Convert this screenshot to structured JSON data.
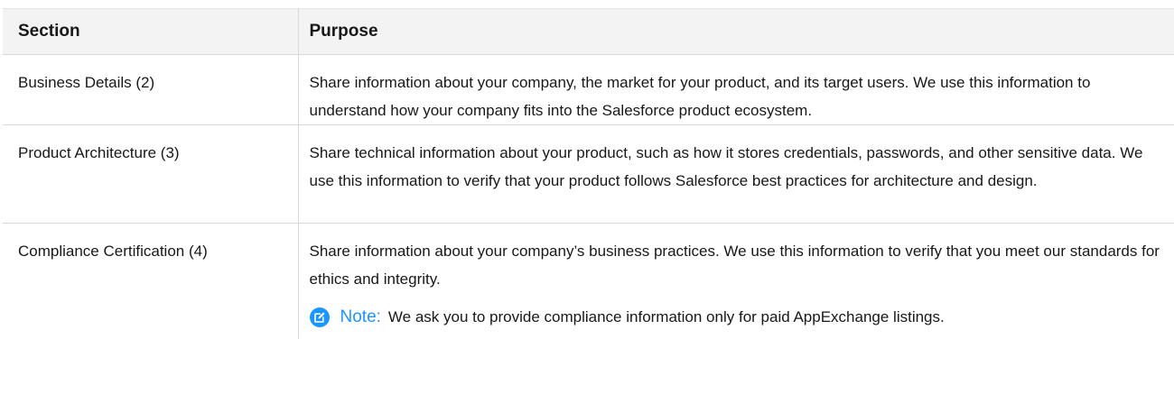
{
  "table": {
    "headers": {
      "section": "Section",
      "purpose": "Purpose"
    },
    "rows": [
      {
        "section": "Business Details (2)",
        "purpose": "Share information about your company, the market for your product, and its target users. We use this information to understand how your company fits into the Salesforce product ecosystem."
      },
      {
        "section": "Product Architecture (3)",
        "purpose": "Share technical information about your product, such as how it stores credentials, passwords, and other sensitive data. We use this information to verify that your product follows Salesforce best practices for architecture and design."
      },
      {
        "section": "Compliance Certification (4)",
        "purpose": "Share information about your company’s business practices. We use this information to verify that you meet our standards for ethics and integrity.",
        "note": {
          "icon": "note-edit-icon",
          "label": "Note:",
          "text": "We ask you to provide compliance information only for paid AppExchange listings."
        }
      }
    ]
  },
  "colors": {
    "accent": "#1b96ff",
    "header_bg": "#f3f3f3",
    "border": "#d8d8d8"
  }
}
